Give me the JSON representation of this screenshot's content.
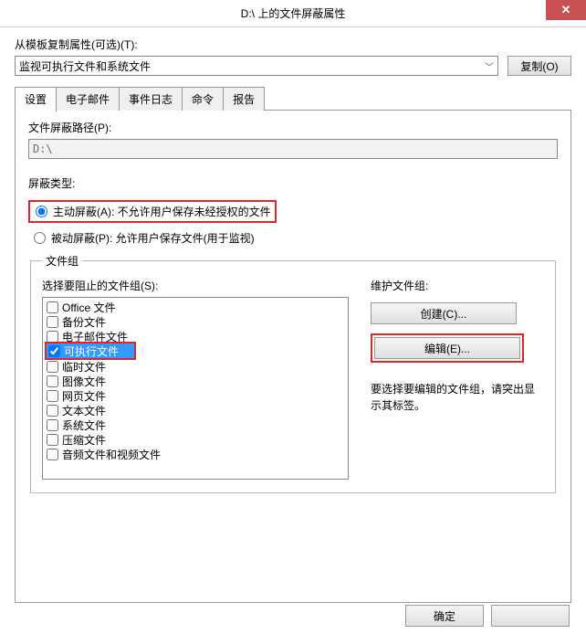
{
  "title": "D:\\ 上的文件屏蔽属性",
  "template": {
    "label": "从模板复制属性(可选)(T):",
    "selected": "监视可执行文件和系统文件",
    "copy_btn": "复制(O)"
  },
  "tabs": [
    "设置",
    "电子邮件",
    "事件日志",
    "命令",
    "报告"
  ],
  "active_tab_index": 0,
  "settings": {
    "path_label": "文件屏蔽路径(P):",
    "path_value": "D:\\",
    "screen_type_label": "屏蔽类型:",
    "radio_active": "主动屏蔽(A): 不允许用户保存未经授权的文件",
    "radio_passive": "被动屏蔽(P): 允许用户保存文件(用于监视)",
    "radio_value": "active",
    "file_group_legend": "文件组",
    "select_group_label": "选择要阻止的文件组(S):",
    "groups": [
      {
        "label": "Office 文件",
        "checked": false,
        "selected": false
      },
      {
        "label": "备份文件",
        "checked": false,
        "selected": false
      },
      {
        "label": "电子邮件文件",
        "checked": false,
        "selected": false
      },
      {
        "label": "可执行文件",
        "checked": true,
        "selected": true,
        "highlighted": true
      },
      {
        "label": "临时文件",
        "checked": false,
        "selected": false
      },
      {
        "label": "图像文件",
        "checked": false,
        "selected": false
      },
      {
        "label": "网页文件",
        "checked": false,
        "selected": false
      },
      {
        "label": "文本文件",
        "checked": false,
        "selected": false
      },
      {
        "label": "系统文件",
        "checked": false,
        "selected": false
      },
      {
        "label": "压缩文件",
        "checked": false,
        "selected": false
      },
      {
        "label": "音频文件和视频文件",
        "checked": false,
        "selected": false
      }
    ],
    "maintain_label": "维护文件组:",
    "create_btn": "创建(C)...",
    "edit_btn": "编辑(E)...",
    "hint": "要选择要编辑的文件组，请突出显示其标签。"
  },
  "buttons": {
    "ok": "确定",
    "cancel": ""
  }
}
